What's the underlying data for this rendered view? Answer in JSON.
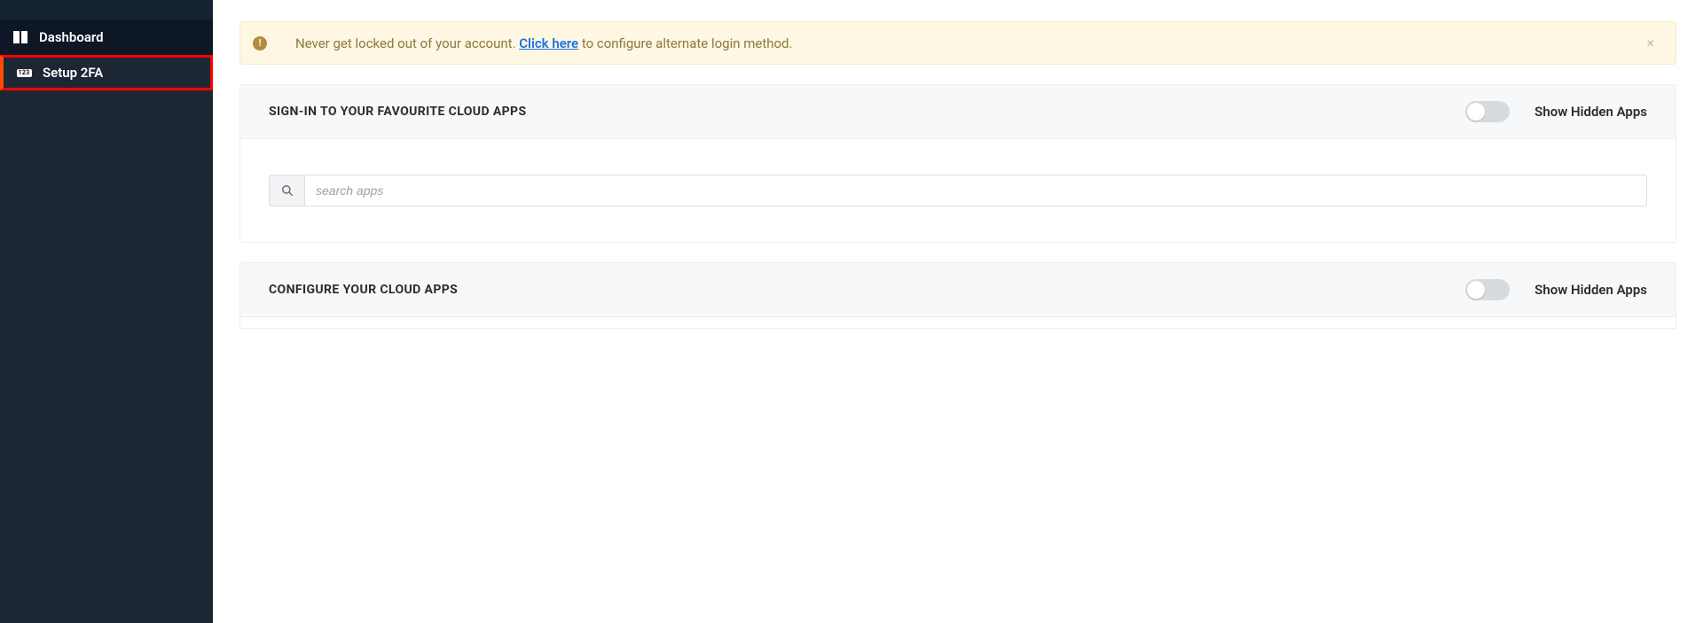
{
  "sidebar": {
    "items": [
      {
        "label": "Dashboard",
        "icon": "dashboard-icon"
      },
      {
        "label": "Setup 2FA",
        "icon": "123-badge"
      }
    ]
  },
  "alert": {
    "text_before": "Never get locked out of your account. ",
    "link_text": "Click here",
    "text_after": " to configure alternate login method."
  },
  "sections": {
    "signin": {
      "title": "SIGN-IN TO YOUR FAVOURITE CLOUD APPS",
      "toggle_label": "Show Hidden Apps",
      "search_placeholder": "search apps"
    },
    "configure": {
      "title": "CONFIGURE YOUR CLOUD APPS",
      "toggle_label": "Show Hidden Apps"
    }
  }
}
